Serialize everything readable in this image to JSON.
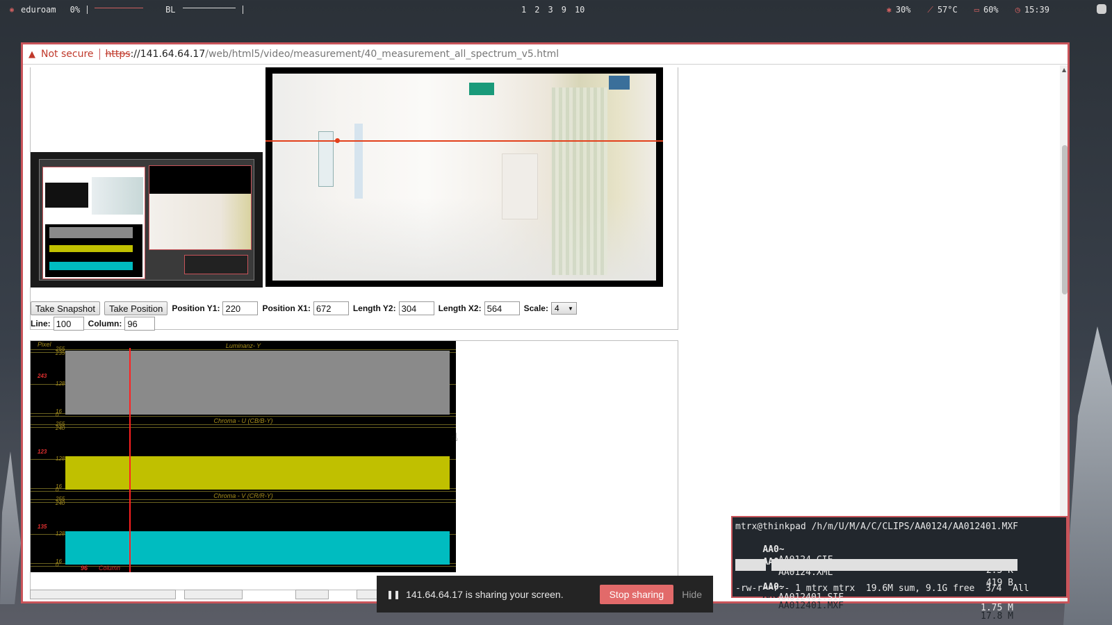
{
  "topbar": {
    "wifi_name": "eduroam",
    "volume": "0%",
    "backlight": "BL",
    "workspaces": [
      "1",
      "2",
      "3",
      "9",
      "10"
    ],
    "cpu": "30%",
    "temp": "57°C",
    "battery": "60%",
    "clock": "15:39"
  },
  "browser": {
    "not_secure": "Not secure",
    "url_scheme": "https",
    "url_host": "://141.64.64.17",
    "url_path": "/web/html5/video/measurement/40_measurement_all_spectrum_v5.html"
  },
  "controls": {
    "take_snapshot": "Take Snapshot",
    "take_position": "Take Position",
    "position_y1_label": "Position Y1:",
    "position_y1": "220",
    "position_x1_label": "Position X1:",
    "position_x1": "672",
    "length_y2_label": "Length Y2:",
    "length_y2": "304",
    "length_x2_label": "Length X2:",
    "length_x2": "564",
    "scale_label": "Scale:",
    "scale": "4",
    "line_label": "Line:",
    "line": "100",
    "column_label": "Column:",
    "column": "96"
  },
  "scope": {
    "pixel_label": "Pixel",
    "lanes": [
      {
        "title": "Luminanz- Y",
        "top_ticks": [
          "255",
          "235"
        ],
        "mid": "128",
        "bottom_ticks": [
          "16",
          "0"
        ],
        "marker": "243",
        "color": "#8a8a8a"
      },
      {
        "title": "Chroma - U (CB/B-Y)",
        "top_ticks": [
          "255",
          "240"
        ],
        "mid": "128",
        "bottom_ticks": [
          "16",
          "0"
        ],
        "marker": "123",
        "color": "#c0c000"
      },
      {
        "title": "Chroma - V (CR/R-Y)",
        "top_ticks": [
          "255",
          "240"
        ],
        "mid": "128",
        "bottom_ticks": [
          "16",
          "0"
        ],
        "marker": "135",
        "color": "#00bcc0"
      }
    ],
    "column_value": "96",
    "column_label": "Column"
  },
  "share": {
    "text": "141.64.64.17 is sharing your screen.",
    "stop": "Stop sharing",
    "hide": "Hide"
  },
  "terminal": {
    "path": "mtrx@thinkpad /h/m/U/M/A/C/CLIPS/AA0124/AA012401.MXF",
    "files": [
      {
        "perm": "AA0~",
        "name": "AA0124.CIF",
        "size": "2.5 K"
      },
      {
        "perm": "AA0~",
        "name": "AA0124.XML",
        "size": "419 B"
      },
      {
        "perm": "AA0~",
        "name": "AA012401.MXF",
        "size": "17.8 M"
      },
      {
        "perm": "AA0~",
        "name": "AA012401.SIF",
        "size": "1.75 M"
      }
    ],
    "status": "-rw-r--r-- 1 mtrx mtrx  19.6M sum, 9.1G free  3/4  All"
  }
}
